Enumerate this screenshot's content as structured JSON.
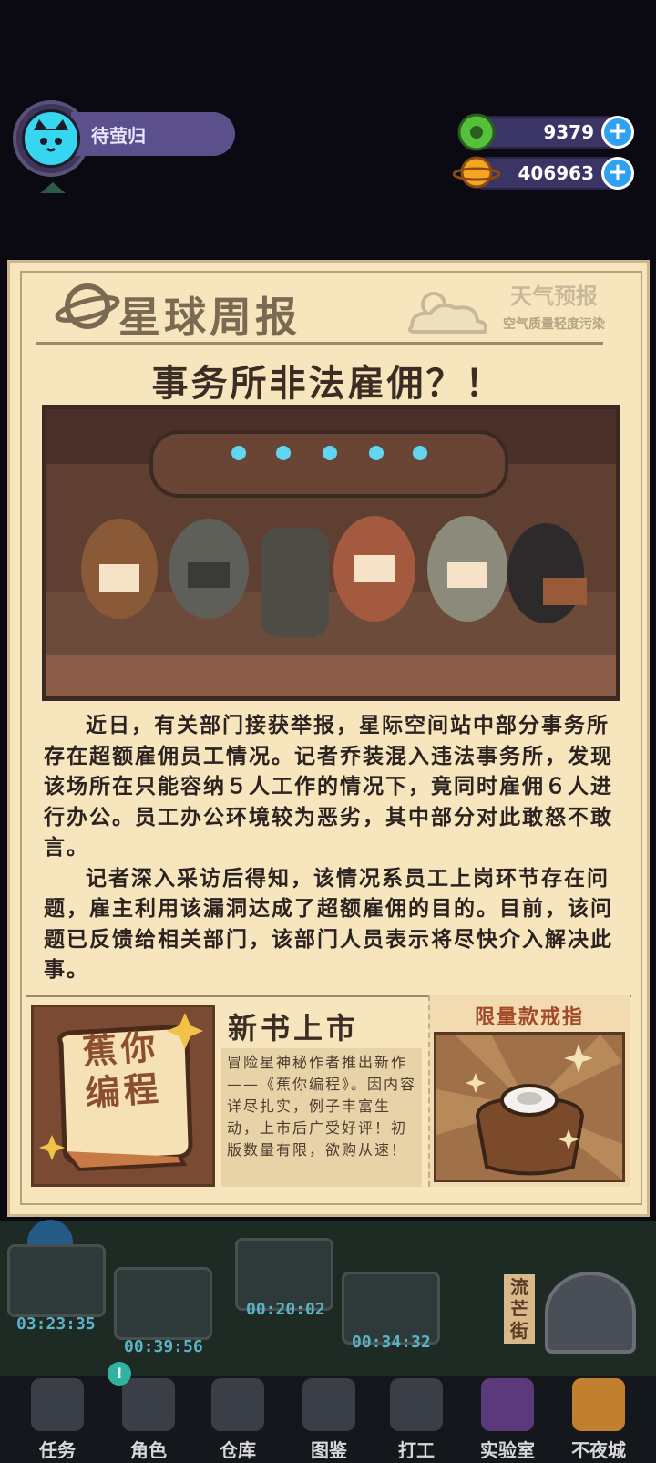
{
  "player": {
    "name": "待萤归"
  },
  "resources": [
    {
      "icon": "green-donut-icon",
      "value": "9379"
    },
    {
      "icon": "planet-coin-icon",
      "value": "406963"
    }
  ],
  "newspaper": {
    "masthead": "星球周报",
    "weather_title": "天气预报",
    "weather_sub": "空气质量轻度污染",
    "headline": "事务所非法雇佣？！",
    "article": [
      "近日，有关部门接获举报，星际空间站中部分事务所存在超额雇佣员工情况。记者乔装混入违法事务所，发现该场所在只能容纳５人工作的情况下，竟同时雇佣６人进行办公。员工办公环境较为恶劣，其中部分对此敢怒不敢言。",
      "记者深入采访后得知，该情况系员工上岗环节存在问题，雇主利用该漏洞达成了超额雇佣的目的。目前，该问题已反馈给相关部门，该部门人员表示将尽快介入解决此事。"
    ],
    "new_book": {
      "title": "新书上市",
      "cover_line1": "蕉你",
      "cover_line2": "编程",
      "description": "冒险星神秘作者推出新作——《蕉你编程》。因内容详尽扎实，例子丰富生动，上市后广受好评！初版数量有限，欲购从速！"
    },
    "ring": {
      "title": "限量款戒指"
    }
  },
  "side_sign": "流芒街",
  "timers": [
    "03:23:35",
    "00:39:56",
    "00:20:02",
    "00:34:32"
  ],
  "nav": [
    {
      "label": "任务",
      "icon": "task-icon"
    },
    {
      "label": "角色",
      "icon": "character-icon"
    },
    {
      "label": "仓库",
      "icon": "warehouse-icon"
    },
    {
      "label": "图鉴",
      "icon": "encyclopedia-icon"
    },
    {
      "label": "打工",
      "icon": "work-icon"
    },
    {
      "label": "实验室",
      "icon": "lab-icon"
    },
    {
      "label": "不夜城",
      "icon": "night-city-icon"
    }
  ]
}
